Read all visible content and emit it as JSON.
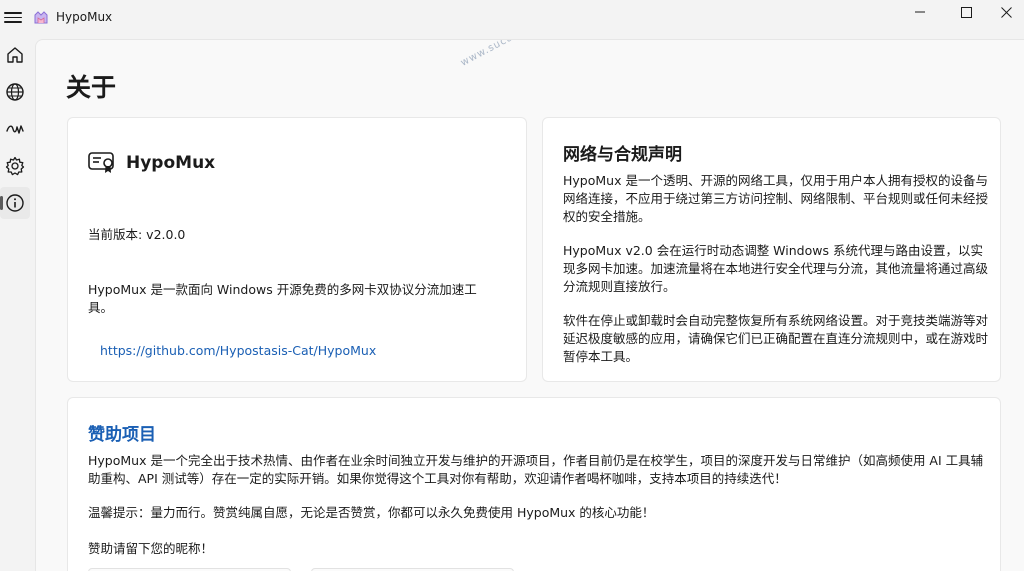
{
  "titlebar": {
    "app_title": "HypoMux",
    "menu_icon": "hamburger-menu-icon",
    "minimize_icon": "minimize-icon",
    "maximize_icon": "maximize-icon",
    "close_icon": "close-icon"
  },
  "nav": {
    "items": [
      {
        "icon": "home-icon",
        "active": false
      },
      {
        "icon": "globe-icon",
        "active": false
      },
      {
        "icon": "routing-icon",
        "active": false
      },
      {
        "icon": "gear-icon",
        "active": false
      },
      {
        "icon": "info-icon",
        "active": true
      }
    ]
  },
  "page": {
    "title": "关于"
  },
  "app_card": {
    "icon": "certificate-icon",
    "name": "HypoMux",
    "version": "当前版本: v2.0.0",
    "description": "HypoMux 是一款面向 Windows 开源免费的多网卡双协议分流加速工具。",
    "repo_link": "https://github.com/Hypostasis-Cat/HypoMux"
  },
  "legal_card": {
    "title": "网络与合规声明",
    "paragraphs": [
      "HypoMux 是一个透明、开源的网络工具，仅用于用户本人拥有授权的设备与网络连接，不应用于绕过第三方访问控制、网络限制、平台规则或任何未经授权的安全措施。",
      "HypoMux v2.0 会在运行时动态调整 Windows 系统代理与路由设置，以实现多网卡加速。加速流量将在本地进行安全代理与分流，其他流量将通过高级分流规则直接放行。",
      "软件在停止或卸载时会自动完整恢复所有系统网络设置。对于竞技类端游等对延迟极度敏感的应用，请确保它们已正确配置在直连分流规则中，或在游戏时暂停本工具。"
    ]
  },
  "sponsor_card": {
    "title": "赞助项目",
    "paragraphs": [
      "HypoMux 是一个完全出于技术热情、由作者在业余时间独立开发与维护的开源项目，作者目前仍是在校学生，项目的深度开发与日常维护（如高频使用 AI 工具辅助重构、API 测试等）存在一定的实际开销。如果你觉得这个工具对你有帮助，欢迎请作者喝杯咖啡，支持本项目的持续迭代！",
      "温馨提示：量力而行。赞赏纯属自愿，无论是否赞赏，你都可以永久免费使用 HypoMux 的核心功能！",
      "赞助请留下您的昵称！"
    ]
  },
  "watermark": "www.sucaizy.com",
  "colors": {
    "accent": "#1a5fb4",
    "background": "#f3f3f3",
    "card": "#ffffff"
  }
}
